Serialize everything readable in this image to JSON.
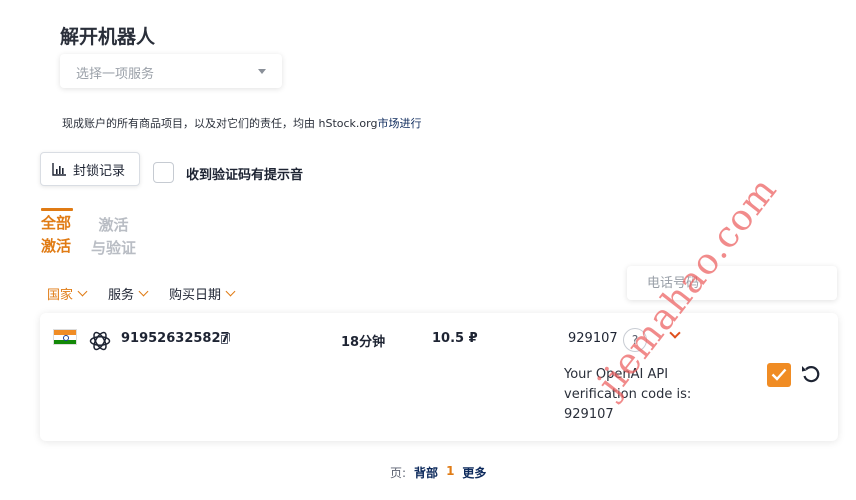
{
  "page": {
    "title": "解开机器人",
    "service_select": {
      "placeholder": "选择一项服务"
    },
    "disclaimer": {
      "text": "现成账户的所有商品项目，以及对它们的责任，均由 hStock.org",
      "link": "市场进行"
    }
  },
  "toolbar": {
    "history_button": "封锁记录",
    "sound_label": "收到验证码有提示音",
    "sound_checked": false
  },
  "tabs": [
    {
      "line1": "全部",
      "line2": "激活",
      "active": true
    },
    {
      "line1": "激活",
      "line2": "与验证",
      "active": false
    }
  ],
  "phone_search": {
    "placeholder": "电话号码",
    "value": ""
  },
  "filters": [
    {
      "label": "国家",
      "active": true
    },
    {
      "label": "服务",
      "active": false
    },
    {
      "label": "购买日期",
      "active": false
    }
  ],
  "orders": [
    {
      "country_flag": "india-flag-icon",
      "service_icon": "openai-icon",
      "phone": "919526325827",
      "duration": "18分钟",
      "price": "10.5 ₽",
      "code": "929107",
      "help": "?",
      "sms_text": "Your OpenAI API verification code is: 929107",
      "completed": true
    }
  ],
  "pagination": {
    "label": "页:",
    "prev": "背部",
    "current": "1",
    "next": "更多"
  },
  "watermark": "jiemahao.com",
  "colors": {
    "accent": "#e07b14",
    "checkbox": "#f08c24",
    "link": "#0d2a5c",
    "watermark": "#ec5e5e"
  }
}
